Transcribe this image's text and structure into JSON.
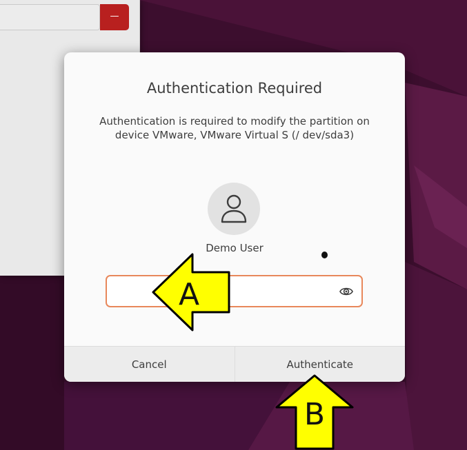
{
  "dialog": {
    "title": "Authentication Required",
    "message": "Authentication is required to modify the partition on device VMware, VMware Virtual S (/ dev/sda3)",
    "username": "Demo User",
    "password": {
      "value": "",
      "placeholder": ""
    },
    "cancel_label": "Cancel",
    "authenticate_label": "Authenticate"
  },
  "background_window": {
    "button_label": "—"
  },
  "annotations": {
    "arrow_a_label": "A",
    "arrow_b_label": "B"
  },
  "icons": {
    "avatar": "user-icon",
    "reveal": "eye-icon"
  },
  "colors": {
    "focus_border": "#e8875a",
    "annotation_fill": "#ffff00",
    "bg_button": "#b8201f"
  }
}
